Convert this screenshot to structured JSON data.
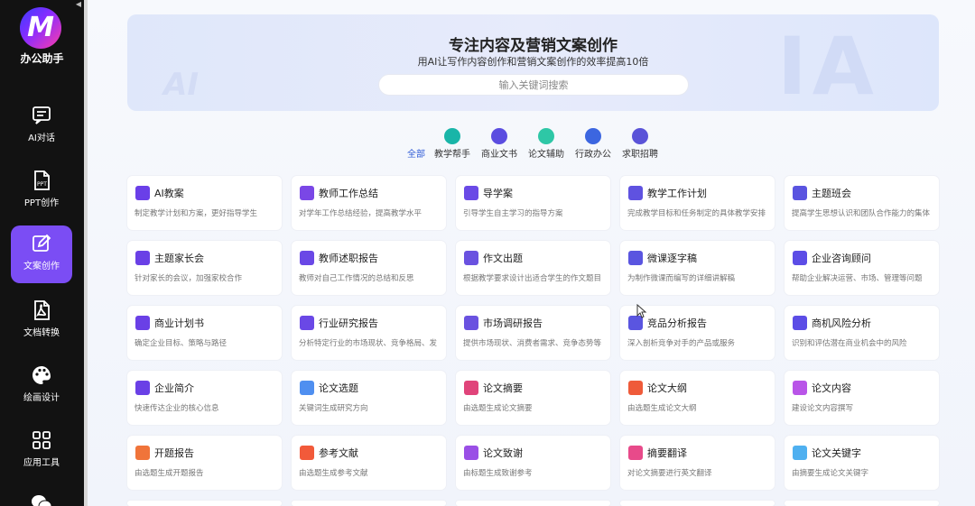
{
  "sidebar": {
    "brand": "办公助手",
    "items": [
      {
        "label": "AI对话",
        "icon": "chat-icon",
        "active": false
      },
      {
        "label": "PPT创作",
        "icon": "ppt-icon",
        "active": false
      },
      {
        "label": "文案创作",
        "icon": "edit-icon",
        "active": true
      },
      {
        "label": "文档转换",
        "icon": "pdf-icon",
        "active": false
      },
      {
        "label": "绘画设计",
        "icon": "palette-icon",
        "active": false
      },
      {
        "label": "应用工具",
        "icon": "apps-icon",
        "active": false
      }
    ]
  },
  "hero": {
    "title": "专注内容及营销文案创作",
    "subtitle": "用AI让写作内容创作和营销文案创作的效率提高10倍",
    "search_placeholder": "输入关键词搜索"
  },
  "tabs": [
    {
      "label": "全部",
      "active": true
    },
    {
      "label": "教学帮手",
      "icon_color": "#19b5a8"
    },
    {
      "label": "商业文书",
      "icon_color": "#5b4de0"
    },
    {
      "label": "论文辅助",
      "icon_color": "#2ec7a6"
    },
    {
      "label": "行政办公",
      "icon_color": "#3c66e0"
    },
    {
      "label": "求职招聘",
      "icon_color": "#5a53d8"
    }
  ],
  "cards": [
    [
      {
        "title": "AI教案",
        "desc": "制定教学计划和方案，更好指导学生",
        "color": "#6a3fe8"
      },
      {
        "title": "教师工作总结",
        "desc": "对学年工作总结经验，提高教学水平",
        "color": "#7a47e6"
      },
      {
        "title": "导学案",
        "desc": "引导学生自主学习的指导方案",
        "color": "#6a4ae6"
      },
      {
        "title": "教学工作计划",
        "desc": "完成教学目标和任务制定的具体教学安排",
        "color": "#5f52e0"
      },
      {
        "title": "主题班会",
        "desc": "提高学生思想认识和团队合作能力的集体",
        "color": "#5a54e0"
      }
    ],
    [
      {
        "title": "主题家长会",
        "desc": "针对家长的会议，加强家校合作",
        "color": "#6a40e6"
      },
      {
        "title": "教师述职报告",
        "desc": "教师对自己工作情况的总结和反思",
        "color": "#6a48e6"
      },
      {
        "title": "作文出题",
        "desc": "根据教学要求设计出适合学生的作文题目",
        "color": "#6a52e0"
      },
      {
        "title": "微课逐字稿",
        "desc": "为制作微课而编写的详细讲解稿",
        "color": "#5a55e0"
      },
      {
        "title": "企业咨询顾问",
        "desc": "帮助企业解决运营、市场、管理等问题",
        "color": "#5c4de6"
      }
    ],
    [
      {
        "title": "商业计划书",
        "desc": "确定企业目标、策略与路径",
        "color": "#6a40e6"
      },
      {
        "title": "行业研究报告",
        "desc": "分析特定行业的市场现状、竞争格局、发",
        "color": "#6a48e6"
      },
      {
        "title": "市场调研报告",
        "desc": "提供市场现状、消费者需求、竞争态势等",
        "color": "#6a52e0"
      },
      {
        "title": "竞品分析报告",
        "desc": "深入剖析竞争对手的产品或服务",
        "color": "#5a55e0"
      },
      {
        "title": "商机风险分析",
        "desc": "识别和评估潜在商业机会中的风险",
        "color": "#5c4de6"
      }
    ],
    [
      {
        "title": "企业简介",
        "desc": "快速传达企业的核心信息",
        "color": "#6a40e6"
      },
      {
        "title": "论文选题",
        "desc": "关键词生成研究方向",
        "color": "#4f8ff0"
      },
      {
        "title": "论文摘要",
        "desc": "由选题生成论文摘要",
        "color": "#e0447a"
      },
      {
        "title": "论文大纲",
        "desc": "由选题生成论文大纲",
        "color": "#ef5b3a"
      },
      {
        "title": "论文内容",
        "desc": "建设论文内容撰写",
        "color": "#b955e8"
      }
    ],
    [
      {
        "title": "开题报告",
        "desc": "由选题生成开题报告",
        "color": "#f0743a"
      },
      {
        "title": "参考文献",
        "desc": "由选题生成参考文献",
        "color": "#f25a3a"
      },
      {
        "title": "论文致谢",
        "desc": "由标题生成致谢参考",
        "color": "#9a4fe6"
      },
      {
        "title": "摘要翻译",
        "desc": "对论文摘要进行英文翻译",
        "color": "#e84a8a"
      },
      {
        "title": "论文关键字",
        "desc": "由摘要生成论文关键字",
        "color": "#4fb0f0"
      }
    ]
  ]
}
